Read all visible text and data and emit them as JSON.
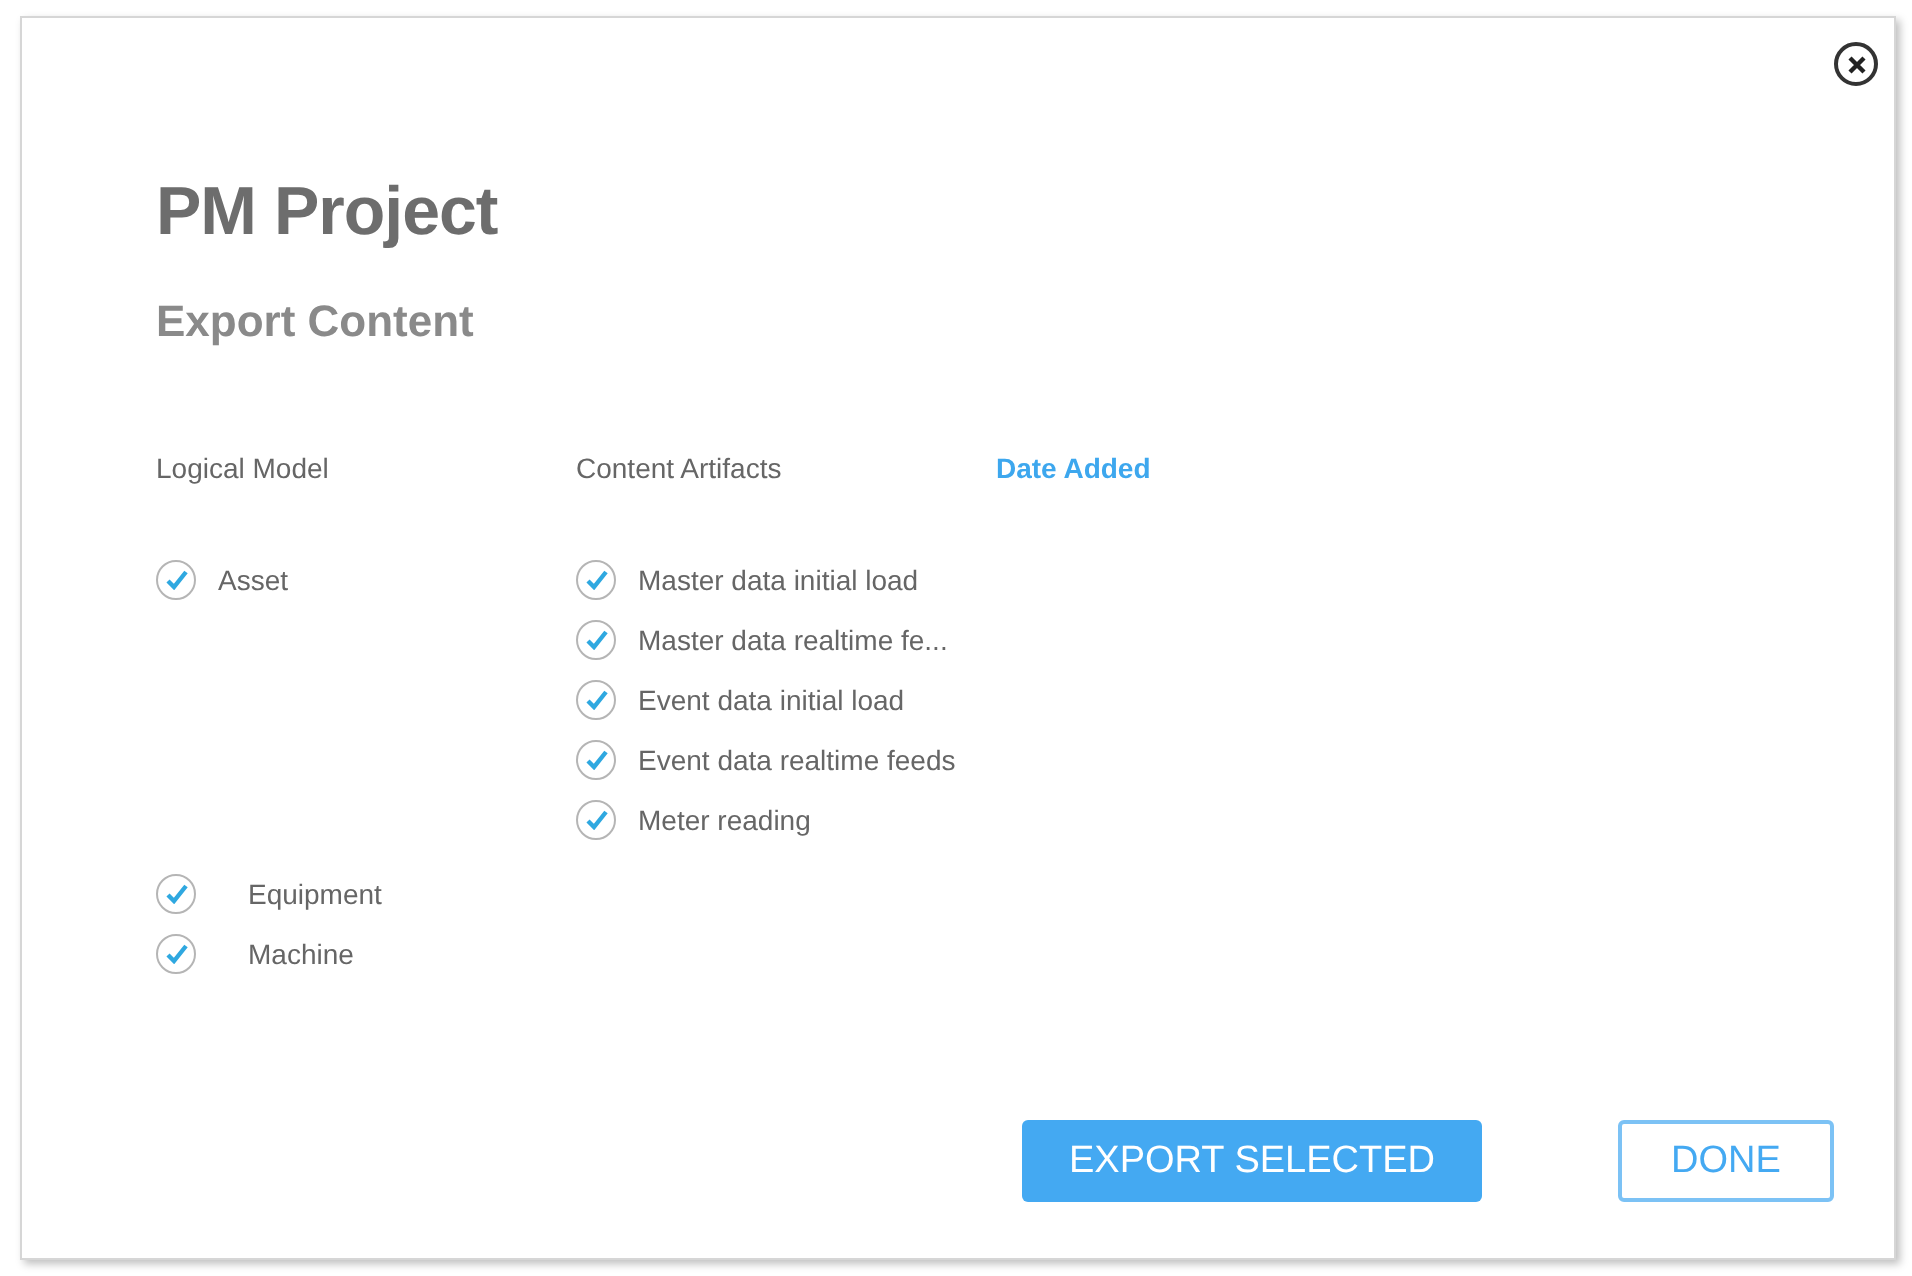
{
  "title": "PM Project",
  "subtitle": "Export Content",
  "columns": [
    "Logical Model",
    "Content Artifacts"
  ],
  "sort_link": "Date Added",
  "models": [
    {
      "label": "Asset",
      "checked": true,
      "artifacts": [
        {
          "label": "Master data initial load",
          "checked": true
        },
        {
          "label": "Master data realtime fe...",
          "checked": true
        },
        {
          "label": "Event data initial load",
          "checked": true
        },
        {
          "label": "Event data realtime feeds",
          "checked": true
        },
        {
          "label": "Meter reading",
          "checked": true
        }
      ],
      "children": [
        {
          "label": "Equipment",
          "checked": true
        },
        {
          "label": "Machine",
          "checked": true
        }
      ]
    }
  ],
  "buttons": [
    {
      "label": "EXPORT SELECTED",
      "kind": "primary"
    },
    {
      "label": "DONE",
      "kind": "secondary"
    }
  ]
}
